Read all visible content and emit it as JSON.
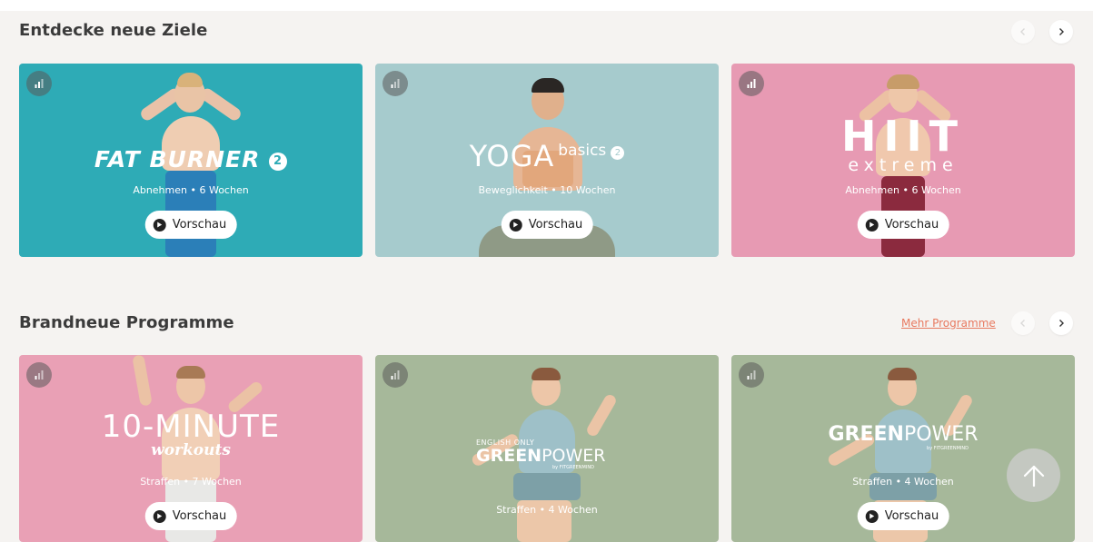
{
  "sections": [
    {
      "title": "Entdecke neue Ziele",
      "cards": [
        {
          "title_main": "FAT BURNER",
          "title_badge": "2",
          "subtitle": "Abnehmen • 6 Wochen",
          "preview_label": "Vorschau",
          "bg": "#2eabb6"
        },
        {
          "title_main": "YOGA",
          "title_sub": "basics",
          "title_badge": "2",
          "subtitle": "Beweglichkeit • 10 Wochen",
          "preview_label": "Vorschau",
          "bg": "#a6cbcd"
        },
        {
          "title_main": "HIIT",
          "title_sub": "extreme",
          "subtitle": "Abnehmen • 6 Wochen",
          "preview_label": "Vorschau",
          "bg": "#e79ab3"
        }
      ]
    },
    {
      "title": "Brandneue Programme",
      "more_link": "Mehr Programme",
      "cards": [
        {
          "title_main": "10-MINUTE",
          "title_sub": "workouts",
          "subtitle": "Straffen • 7 Wochen",
          "preview_label": "Vorschau",
          "bg": "#e9a0b5"
        },
        {
          "title_pre": "ENGLISH ONLY",
          "title_main_a": "GREEN",
          "title_main_b": "POWER",
          "title_by": "by FITGREENMIND",
          "subtitle": "Straffen • 4 Wochen",
          "bg": "#a6b89a"
        },
        {
          "title_main_a": "GREEN",
          "title_main_b": "POWER",
          "title_by": "by FITGREENMIND",
          "subtitle": "Straffen • 4 Wochen",
          "preview_label": "Vorschau",
          "bg": "#a6b89a"
        }
      ]
    }
  ],
  "icons": {
    "level": "signal-bars-icon",
    "play": "play-icon",
    "prev": "chevron-left-icon",
    "next": "chevron-right-icon",
    "scroll_top": "arrow-up-icon"
  },
  "colors": {
    "accent_link": "#e8795f",
    "page_bg": "#f5f3f1"
  }
}
